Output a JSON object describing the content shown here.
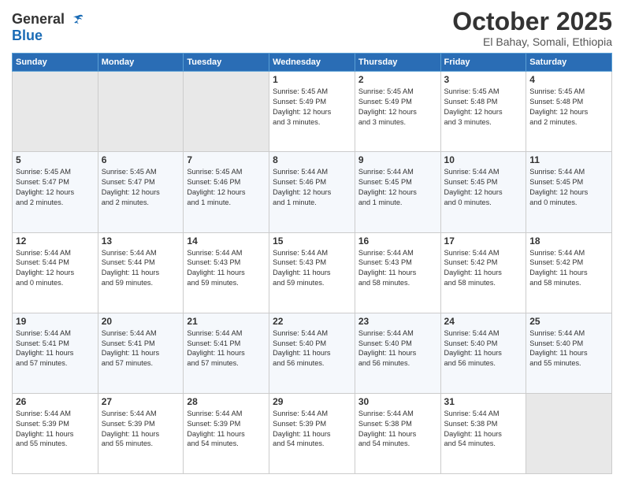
{
  "header": {
    "logo_general": "General",
    "logo_blue": "Blue",
    "month_title": "October 2025",
    "location": "El Bahay, Somali, Ethiopia"
  },
  "weekdays": [
    "Sunday",
    "Monday",
    "Tuesday",
    "Wednesday",
    "Thursday",
    "Friday",
    "Saturday"
  ],
  "weeks": [
    [
      {
        "day": "",
        "info": ""
      },
      {
        "day": "",
        "info": ""
      },
      {
        "day": "",
        "info": ""
      },
      {
        "day": "1",
        "info": "Sunrise: 5:45 AM\nSunset: 5:49 PM\nDaylight: 12 hours\nand 3 minutes."
      },
      {
        "day": "2",
        "info": "Sunrise: 5:45 AM\nSunset: 5:49 PM\nDaylight: 12 hours\nand 3 minutes."
      },
      {
        "day": "3",
        "info": "Sunrise: 5:45 AM\nSunset: 5:48 PM\nDaylight: 12 hours\nand 3 minutes."
      },
      {
        "day": "4",
        "info": "Sunrise: 5:45 AM\nSunset: 5:48 PM\nDaylight: 12 hours\nand 2 minutes."
      }
    ],
    [
      {
        "day": "5",
        "info": "Sunrise: 5:45 AM\nSunset: 5:47 PM\nDaylight: 12 hours\nand 2 minutes."
      },
      {
        "day": "6",
        "info": "Sunrise: 5:45 AM\nSunset: 5:47 PM\nDaylight: 12 hours\nand 2 minutes."
      },
      {
        "day": "7",
        "info": "Sunrise: 5:45 AM\nSunset: 5:46 PM\nDaylight: 12 hours\nand 1 minute."
      },
      {
        "day": "8",
        "info": "Sunrise: 5:44 AM\nSunset: 5:46 PM\nDaylight: 12 hours\nand 1 minute."
      },
      {
        "day": "9",
        "info": "Sunrise: 5:44 AM\nSunset: 5:45 PM\nDaylight: 12 hours\nand 1 minute."
      },
      {
        "day": "10",
        "info": "Sunrise: 5:44 AM\nSunset: 5:45 PM\nDaylight: 12 hours\nand 0 minutes."
      },
      {
        "day": "11",
        "info": "Sunrise: 5:44 AM\nSunset: 5:45 PM\nDaylight: 12 hours\nand 0 minutes."
      }
    ],
    [
      {
        "day": "12",
        "info": "Sunrise: 5:44 AM\nSunset: 5:44 PM\nDaylight: 12 hours\nand 0 minutes."
      },
      {
        "day": "13",
        "info": "Sunrise: 5:44 AM\nSunset: 5:44 PM\nDaylight: 11 hours\nand 59 minutes."
      },
      {
        "day": "14",
        "info": "Sunrise: 5:44 AM\nSunset: 5:43 PM\nDaylight: 11 hours\nand 59 minutes."
      },
      {
        "day": "15",
        "info": "Sunrise: 5:44 AM\nSunset: 5:43 PM\nDaylight: 11 hours\nand 59 minutes."
      },
      {
        "day": "16",
        "info": "Sunrise: 5:44 AM\nSunset: 5:43 PM\nDaylight: 11 hours\nand 58 minutes."
      },
      {
        "day": "17",
        "info": "Sunrise: 5:44 AM\nSunset: 5:42 PM\nDaylight: 11 hours\nand 58 minutes."
      },
      {
        "day": "18",
        "info": "Sunrise: 5:44 AM\nSunset: 5:42 PM\nDaylight: 11 hours\nand 58 minutes."
      }
    ],
    [
      {
        "day": "19",
        "info": "Sunrise: 5:44 AM\nSunset: 5:41 PM\nDaylight: 11 hours\nand 57 minutes."
      },
      {
        "day": "20",
        "info": "Sunrise: 5:44 AM\nSunset: 5:41 PM\nDaylight: 11 hours\nand 57 minutes."
      },
      {
        "day": "21",
        "info": "Sunrise: 5:44 AM\nSunset: 5:41 PM\nDaylight: 11 hours\nand 57 minutes."
      },
      {
        "day": "22",
        "info": "Sunrise: 5:44 AM\nSunset: 5:40 PM\nDaylight: 11 hours\nand 56 minutes."
      },
      {
        "day": "23",
        "info": "Sunrise: 5:44 AM\nSunset: 5:40 PM\nDaylight: 11 hours\nand 56 minutes."
      },
      {
        "day": "24",
        "info": "Sunrise: 5:44 AM\nSunset: 5:40 PM\nDaylight: 11 hours\nand 56 minutes."
      },
      {
        "day": "25",
        "info": "Sunrise: 5:44 AM\nSunset: 5:40 PM\nDaylight: 11 hours\nand 55 minutes."
      }
    ],
    [
      {
        "day": "26",
        "info": "Sunrise: 5:44 AM\nSunset: 5:39 PM\nDaylight: 11 hours\nand 55 minutes."
      },
      {
        "day": "27",
        "info": "Sunrise: 5:44 AM\nSunset: 5:39 PM\nDaylight: 11 hours\nand 55 minutes."
      },
      {
        "day": "28",
        "info": "Sunrise: 5:44 AM\nSunset: 5:39 PM\nDaylight: 11 hours\nand 54 minutes."
      },
      {
        "day": "29",
        "info": "Sunrise: 5:44 AM\nSunset: 5:39 PM\nDaylight: 11 hours\nand 54 minutes."
      },
      {
        "day": "30",
        "info": "Sunrise: 5:44 AM\nSunset: 5:38 PM\nDaylight: 11 hours\nand 54 minutes."
      },
      {
        "day": "31",
        "info": "Sunrise: 5:44 AM\nSunset: 5:38 PM\nDaylight: 11 hours\nand 54 minutes."
      },
      {
        "day": "",
        "info": ""
      }
    ]
  ]
}
